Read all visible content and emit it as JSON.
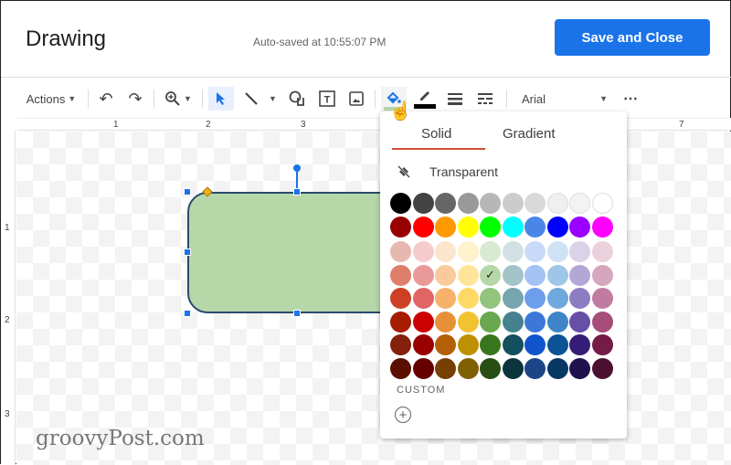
{
  "header": {
    "title": "Drawing",
    "autosave": "Auto-saved at 10:55:07 PM",
    "save_button": "Save and Close"
  },
  "toolbar": {
    "actions_label": "Actions",
    "font_name": "Arial",
    "fill_color": "#b6d7a8",
    "border_color": "#000000"
  },
  "ruler": {
    "horizontal": [
      "1",
      "2",
      "3",
      "7"
    ],
    "vertical": [
      "1",
      "2",
      "3"
    ]
  },
  "fill_popup": {
    "tabs": [
      {
        "label": "Solid",
        "active": true
      },
      {
        "label": "Gradient",
        "active": false
      }
    ],
    "transparent_label": "Transparent",
    "custom_label": "CUSTOM",
    "selected_color": "#b6d7a8",
    "palette": [
      [
        "#000000",
        "#434343",
        "#666666",
        "#999999",
        "#b7b7b7",
        "#cccccc",
        "#d9d9d9",
        "#efefef",
        "#f3f3f3",
        "#ffffff"
      ],
      [
        "#980000",
        "#ff0000",
        "#ff9900",
        "#ffff00",
        "#00ff00",
        "#00ffff",
        "#4a86e8",
        "#0000ff",
        "#9900ff",
        "#ff00ff"
      ],
      [
        "#e6b8af",
        "#f4cccc",
        "#fce5cd",
        "#fff2cc",
        "#d9ead3",
        "#d0e0e3",
        "#c9daf8",
        "#cfe2f3",
        "#d9d2e9",
        "#ead1dc"
      ],
      [
        "#dd7e6b",
        "#ea9999",
        "#f9cb9c",
        "#ffe599",
        "#b6d7a8",
        "#a2c4c9",
        "#a4c2f4",
        "#9fc5e8",
        "#b4a7d6",
        "#d5a6bd"
      ],
      [
        "#cc4125",
        "#e06666",
        "#f6b26b",
        "#ffd966",
        "#93c47d",
        "#76a5af",
        "#6d9eeb",
        "#6fa8dc",
        "#8e7cc3",
        "#c27ba0"
      ],
      [
        "#a61c00",
        "#cc0000",
        "#e69138",
        "#f1c232",
        "#6aa84f",
        "#45818e",
        "#3c78d8",
        "#3d85c6",
        "#674ea7",
        "#a64d79"
      ],
      [
        "#85200c",
        "#990000",
        "#b45f06",
        "#bf9000",
        "#38761d",
        "#134f5c",
        "#1155cc",
        "#0b5394",
        "#351c75",
        "#741b47"
      ],
      [
        "#5b0f00",
        "#660000",
        "#783f04",
        "#7f6000",
        "#274e13",
        "#0c343d",
        "#1c4587",
        "#073763",
        "#20124d",
        "#4c1130"
      ]
    ]
  },
  "watermark": "groovyPost.com"
}
